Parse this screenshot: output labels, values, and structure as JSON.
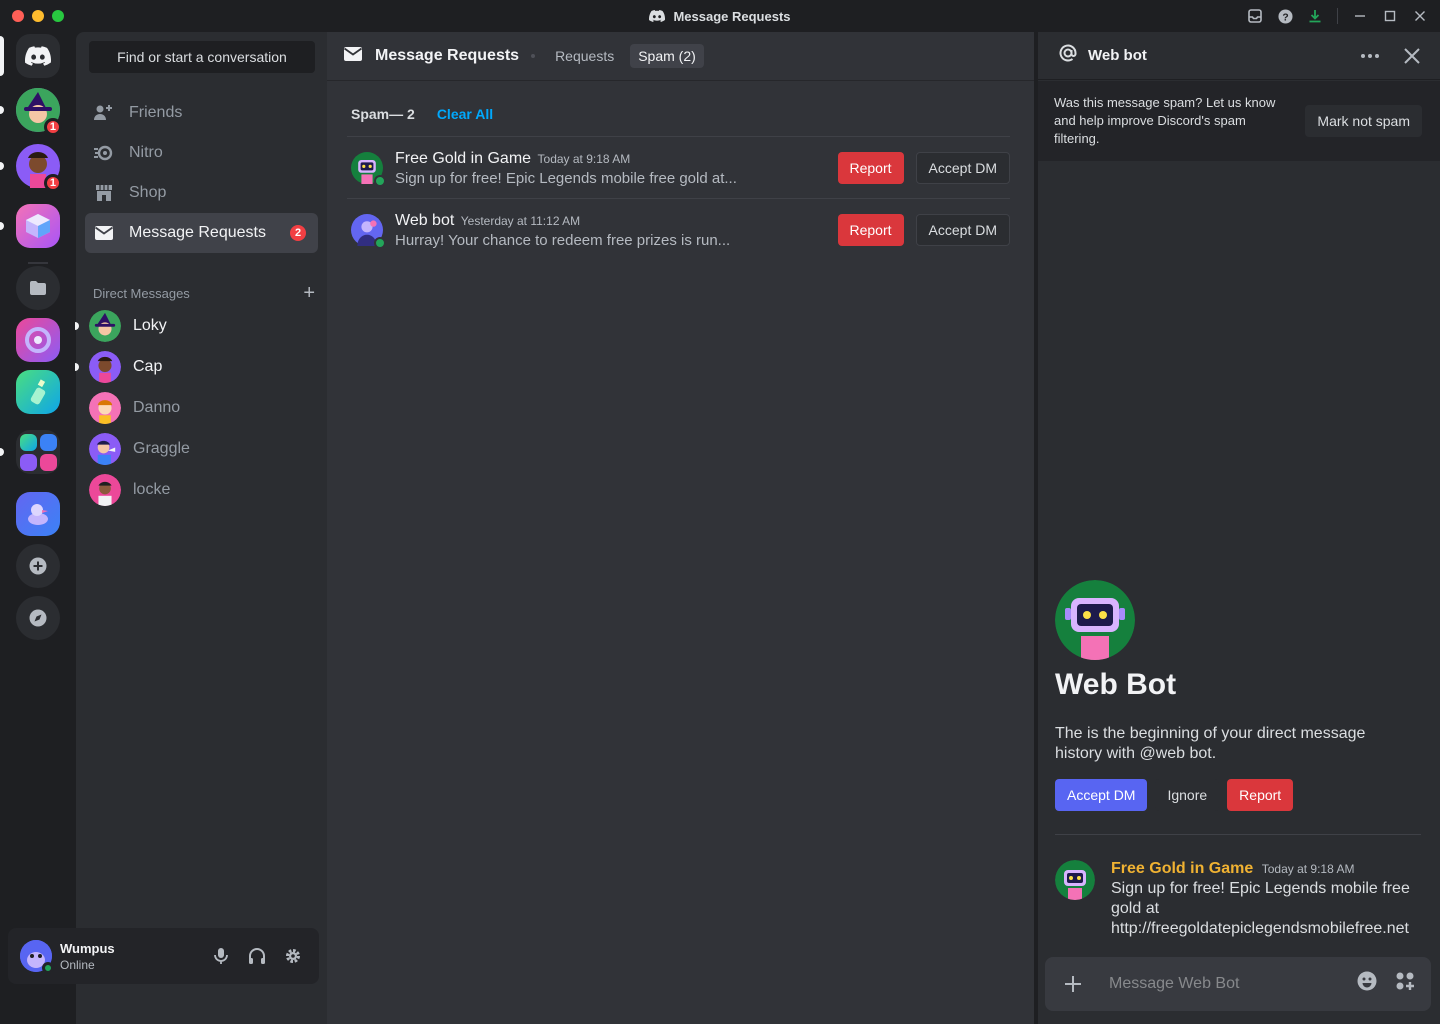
{
  "window": {
    "title": "Message Requests"
  },
  "sidebar": {
    "search_label": "Find or start a conversation",
    "nav": [
      {
        "label": "Friends"
      },
      {
        "label": "Nitro"
      },
      {
        "label": "Shop"
      },
      {
        "label": "Message Requests",
        "badge": "2"
      }
    ],
    "dm_header": "Direct Messages",
    "dms": [
      {
        "name": "Loky"
      },
      {
        "name": "Cap"
      },
      {
        "name": "Danno"
      },
      {
        "name": "Graggle"
      },
      {
        "name": "locke"
      }
    ]
  },
  "rail": {
    "badges": [
      "1",
      "1"
    ]
  },
  "user": {
    "name": "Wumpus",
    "status": "Online"
  },
  "main": {
    "title": "Message Requests",
    "tabs": [
      {
        "label": "Requests"
      },
      {
        "label": "Spam (2)"
      }
    ],
    "spam_count": "Spam— 2",
    "clear_all": "Clear All",
    "requests": [
      {
        "name": "Free Gold in Game",
        "time": "Today at 9:18 AM",
        "message": "Sign up for free! Epic Legends mobile free gold at...",
        "report": "Report",
        "accept": "Accept DM"
      },
      {
        "name": "Web bot",
        "time": "Yesterday at 11:12 AM",
        "message": "Hurray! Your chance to redeem free prizes is run...",
        "report": "Report",
        "accept": "Accept DM"
      }
    ]
  },
  "panel": {
    "title": "Web bot",
    "notice": "Was this message spam? Let us know and help improve Discord's spam filtering.",
    "mark_not_spam": "Mark not spam",
    "profile_name": "Web Bot",
    "intro": "The is the beginning of your direct message history with @web bot.",
    "accept": "Accept DM",
    "ignore": "Ignore",
    "report": "Report",
    "message": {
      "author": "Free Gold in Game",
      "time": "Today at 9:18 AM",
      "body": "Sign up for free! Epic Legends mobile free gold at http://freegoldatepiclegendsmobilefree.net"
    },
    "composer_placeholder": "Message Web Bot"
  }
}
